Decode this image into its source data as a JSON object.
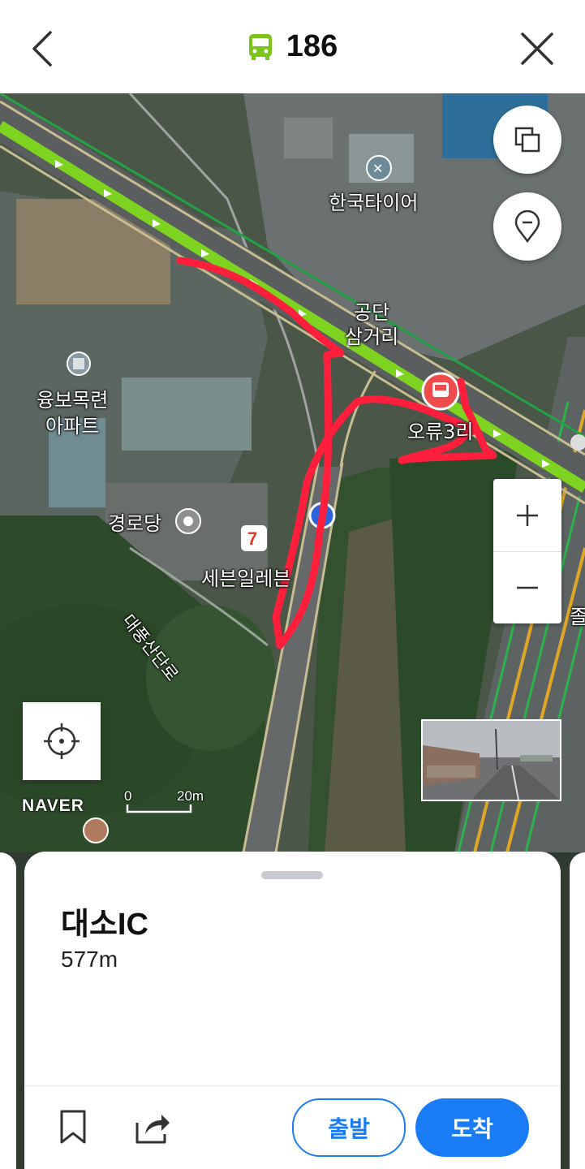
{
  "header": {
    "bus_number": "186",
    "bus_icon_color": "#7cc31a"
  },
  "map": {
    "labels": {
      "hankook_tire": "한국타이어",
      "gongdan_intersection": "공단\n삼거리",
      "yungbo_apartment": "융보목련\n아파트",
      "senior_center": "경로당",
      "seven_eleven": "세븐일레븐",
      "daepungsan_road": "대풍산단로",
      "bus_stop": "오류3리",
      "right_edge": "졸"
    },
    "attribution": "NAVER",
    "scale": {
      "zero": "0",
      "distance": "20m"
    },
    "route_color": "#7ed321",
    "annotation_color": "#ff1f3d"
  },
  "sheet": {
    "stop_name": "대소IC",
    "distance": "577m",
    "depart_label": "출발",
    "arrive_label": "도착",
    "accent_color": "#1a7cf5"
  }
}
